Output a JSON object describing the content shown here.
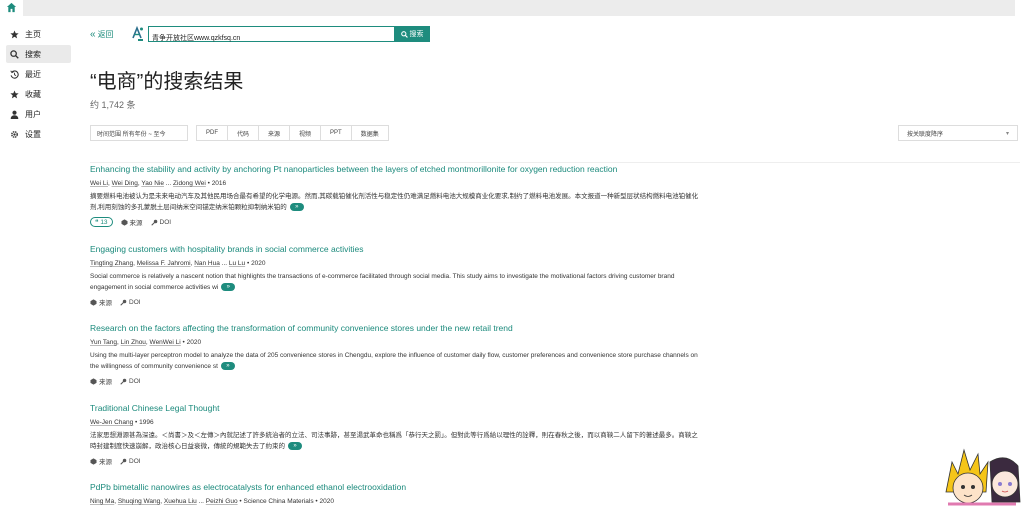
{
  "sidebar": {
    "items": [
      {
        "label": "主页",
        "icon": "star-icon"
      },
      {
        "label": "搜索",
        "icon": "search-icon"
      },
      {
        "label": "最近",
        "icon": "history-icon"
      },
      {
        "label": "收藏",
        "icon": "star-icon"
      },
      {
        "label": "用户",
        "icon": "user-icon"
      },
      {
        "label": "设置",
        "icon": "gear-icon"
      }
    ]
  },
  "header": {
    "back_label": "返回",
    "search_value": "青争开放社区www.qzkfsq.cn",
    "search_button": "搜索"
  },
  "results_title": "“电商”的搜索结果",
  "results_count": "约 1,742 条",
  "filters": {
    "time_range": "时间范围  所有年份 ~ 至今",
    "types": [
      "PDF",
      "代码",
      "来源",
      "视频",
      "PPT",
      "数据集"
    ],
    "sort": "按关联度降序"
  },
  "results": [
    {
      "title": "Enhancing the stability and activity by anchoring Pt nanoparticles between the layers of etched montmorillonite for oxygen reduction reaction",
      "authors": [
        "Wei Li",
        "Wei Ding",
        "Yao Nie",
        "Zidong Wei"
      ],
      "year": "2016",
      "venue": "",
      "abstract": "摘要燃料电池被认为是未来电动汽车及其他民用场合最有希望的化学电源。然而,其碳载铂催化剂活性与稳定性仍难满足燃料电池大规模商业化要求,制约了燃料电池发展。本文报道一种新型层状结构燃料电池铂催化剂,利用刻蚀的多孔蒙脱土层间纳米空间锚定纳米铂颗粒抑制纳米铂的",
      "cite_count": "13",
      "source_label": "来源",
      "doi_label": "DOI"
    },
    {
      "title": "Engaging customers with hospitality brands in social commerce activities",
      "authors": [
        "Tingting Zhang",
        "Melissa F. Jahromi",
        "Nan Hua",
        "Lu Lu"
      ],
      "year": "2020",
      "venue": "",
      "abstract": "Social commerce is relatively a nascent notion that highlights the transactions of e-commerce facilitated through social media. This study aims to investigate the motivational factors driving customer brand engagement in social commerce activities wi",
      "cite_count": "",
      "source_label": "来源",
      "doi_label": "DOI"
    },
    {
      "title": "Research on the factors affecting the transformation of community convenience stores under the new retail trend",
      "authors": [
        "Yun Tang",
        "Lin Zhou",
        "WenWei Li"
      ],
      "year": "2020",
      "venue": "",
      "abstract": "Using the multi-layer perceptron model to analyze the data of 205 convenience stores in Chengdu, explore the influence of customer daily flow, customer preferences and convenience store purchase channels on the willingness of community convenience st",
      "cite_count": "",
      "source_label": "来源",
      "doi_label": "DOI"
    },
    {
      "title": "Traditional Chinese Legal Thought",
      "authors": [
        "We-Jen Chang"
      ],
      "year": "1996",
      "venue": "",
      "abstract": "法家思想淵源甚為深遠。＜尚書＞及＜左傳＞內就記述了許多統治者的立法、司法事跡，甚至湯武革命也稱爲「恭行天之罰」。但對此等行爲給以理性的詮釋，則在春秋之後，而以商鞅二人留下的著述最多。商鞅之時封建制度快速崩解，政治核心日益衰微，傳統的規範失去了約束的",
      "cite_count": "",
      "source_label": "来源",
      "doi_label": "DOI"
    },
    {
      "title": "PdPb bimetallic nanowires as electrocatalysts for enhanced ethanol electrooxidation",
      "authors": [
        "Ning Ma",
        "Shuqing Wang",
        "Xuehua Liu",
        "Peizhi Guo"
      ],
      "year": "2020",
      "venue": "Science China Materials",
      "abstract": "",
      "cite_count": "",
      "source_label": "",
      "doi_label": ""
    }
  ],
  "colors": {
    "accent": "#1e8c7e",
    "link": "#1b8a7c"
  }
}
